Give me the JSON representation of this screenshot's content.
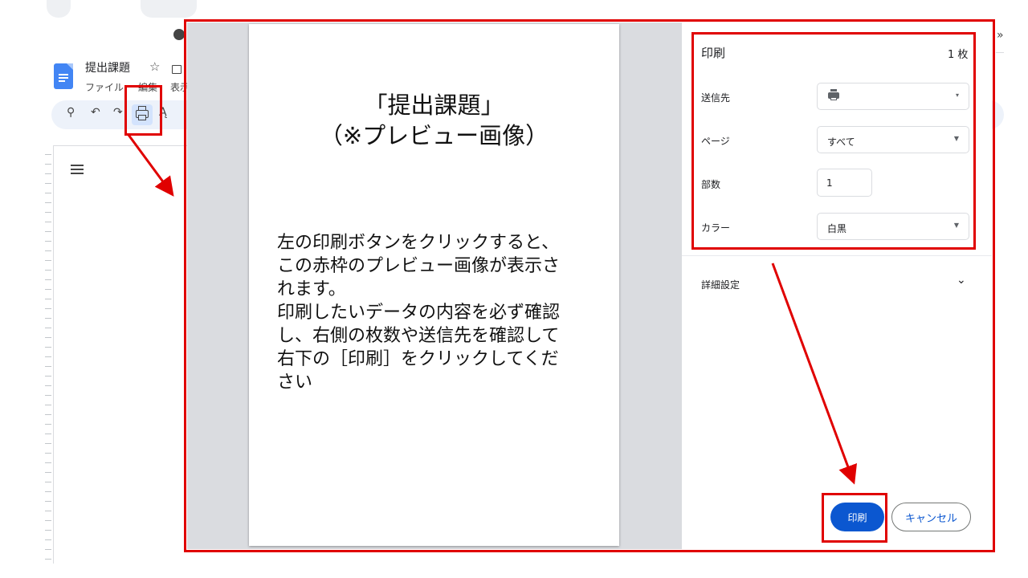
{
  "doc": {
    "title": "提出課題",
    "menu_file": "ファイル",
    "menu_edit": "編集",
    "menu_view": "表示"
  },
  "toolbar": {
    "search_icon": "magnifier-glyph",
    "undo_icon": "undo-arrow",
    "redo_icon": "redo-arrow",
    "print_icon": "printer",
    "spellcheck_icon": "spellcheck"
  },
  "preview": {
    "title": "「提出課題」\n（※プレビュー画像）",
    "body": "左の印刷ボタンをクリックすると、\nこの赤枠のプレビュー画像が表示さ\nれます。\n印刷したいデータの内容を必ず確認\nし、右側の枚数や送信先を確認して\n右下の［印刷］をクリックしてくだ\nさい"
  },
  "print_settings": {
    "title": "印刷",
    "sheet_count": "1 枚",
    "destination_label": "送信先",
    "destination_value_icon": "printer-icon",
    "pages_label": "ページ",
    "pages_value": "すべて",
    "copies_label": "部数",
    "copies_value": "1",
    "color_label": "カラー",
    "color_value": "白黒",
    "advanced_label": "詳細設定",
    "print_button": "印刷",
    "cancel_button": "キャンセル"
  },
  "annotation": {
    "color": "#e00000"
  }
}
